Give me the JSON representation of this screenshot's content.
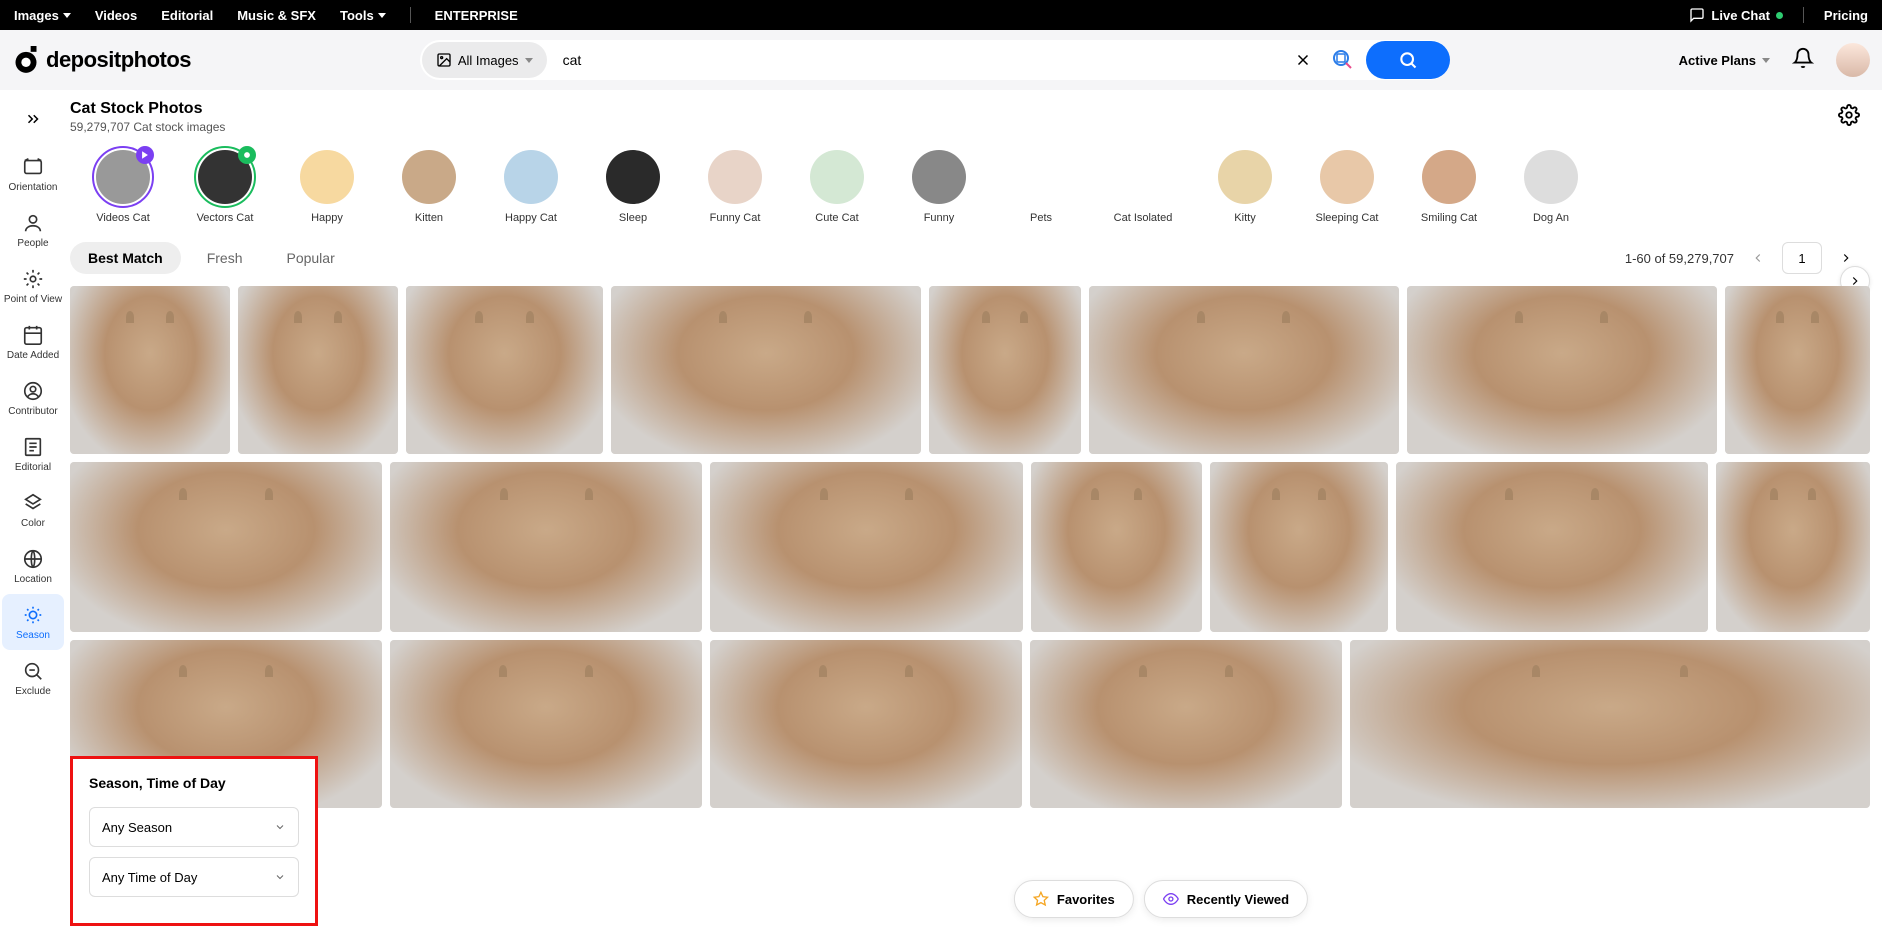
{
  "topnav": {
    "left": [
      "Images",
      "Videos",
      "Editorial",
      "Music & SFX",
      "Tools",
      "ENTERPRISE"
    ],
    "left_dropdowns": [
      true,
      false,
      false,
      false,
      true,
      false
    ],
    "live_chat": "Live Chat",
    "pricing": "Pricing"
  },
  "logo_text": "depositphotos",
  "search": {
    "filter_pill": "All Images",
    "value": "cat"
  },
  "plans_label": "Active Plans",
  "page": {
    "title": "Cat Stock Photos",
    "subtitle": "59,279,707 Cat stock images"
  },
  "sidebar": {
    "items": [
      {
        "label": "Orientation"
      },
      {
        "label": "People"
      },
      {
        "label": "Point of View"
      },
      {
        "label": "Date Added"
      },
      {
        "label": "Contributor"
      },
      {
        "label": "Editorial"
      },
      {
        "label": "Color"
      },
      {
        "label": "Location"
      },
      {
        "label": "Season"
      },
      {
        "label": "Exclude"
      }
    ],
    "active_index": 8
  },
  "categories": [
    {
      "label": "Videos Cat",
      "ring": "purple",
      "badge": "purple"
    },
    {
      "label": "Vectors Cat",
      "ring": "green",
      "badge": "green"
    },
    {
      "label": "Happy"
    },
    {
      "label": "Kitten"
    },
    {
      "label": "Happy Cat"
    },
    {
      "label": "Sleep"
    },
    {
      "label": "Funny Cat"
    },
    {
      "label": "Cute Cat"
    },
    {
      "label": "Funny"
    },
    {
      "label": "Pets"
    },
    {
      "label": "Cat Isolated"
    },
    {
      "label": "Kitty"
    },
    {
      "label": "Sleeping Cat"
    },
    {
      "label": "Smiling Cat"
    },
    {
      "label": "Dog An"
    }
  ],
  "sort_tabs": [
    "Best Match",
    "Fresh",
    "Popular"
  ],
  "sort_active": 0,
  "pagination": {
    "range": "1-60 of 59,279,707",
    "page": "1"
  },
  "gallery": {
    "row1": [
      130,
      130,
      160,
      252,
      124,
      252,
      252,
      118
    ],
    "row2": [
      252,
      252,
      252,
      138,
      144,
      252,
      124
    ],
    "row3": [
      252,
      252,
      252,
      252,
      420
    ]
  },
  "bottom": {
    "favorites": "Favorites",
    "recent": "Recently Viewed"
  },
  "popup": {
    "title": "Season, Time of Day",
    "season": "Any Season",
    "time": "Any Time of Day"
  }
}
